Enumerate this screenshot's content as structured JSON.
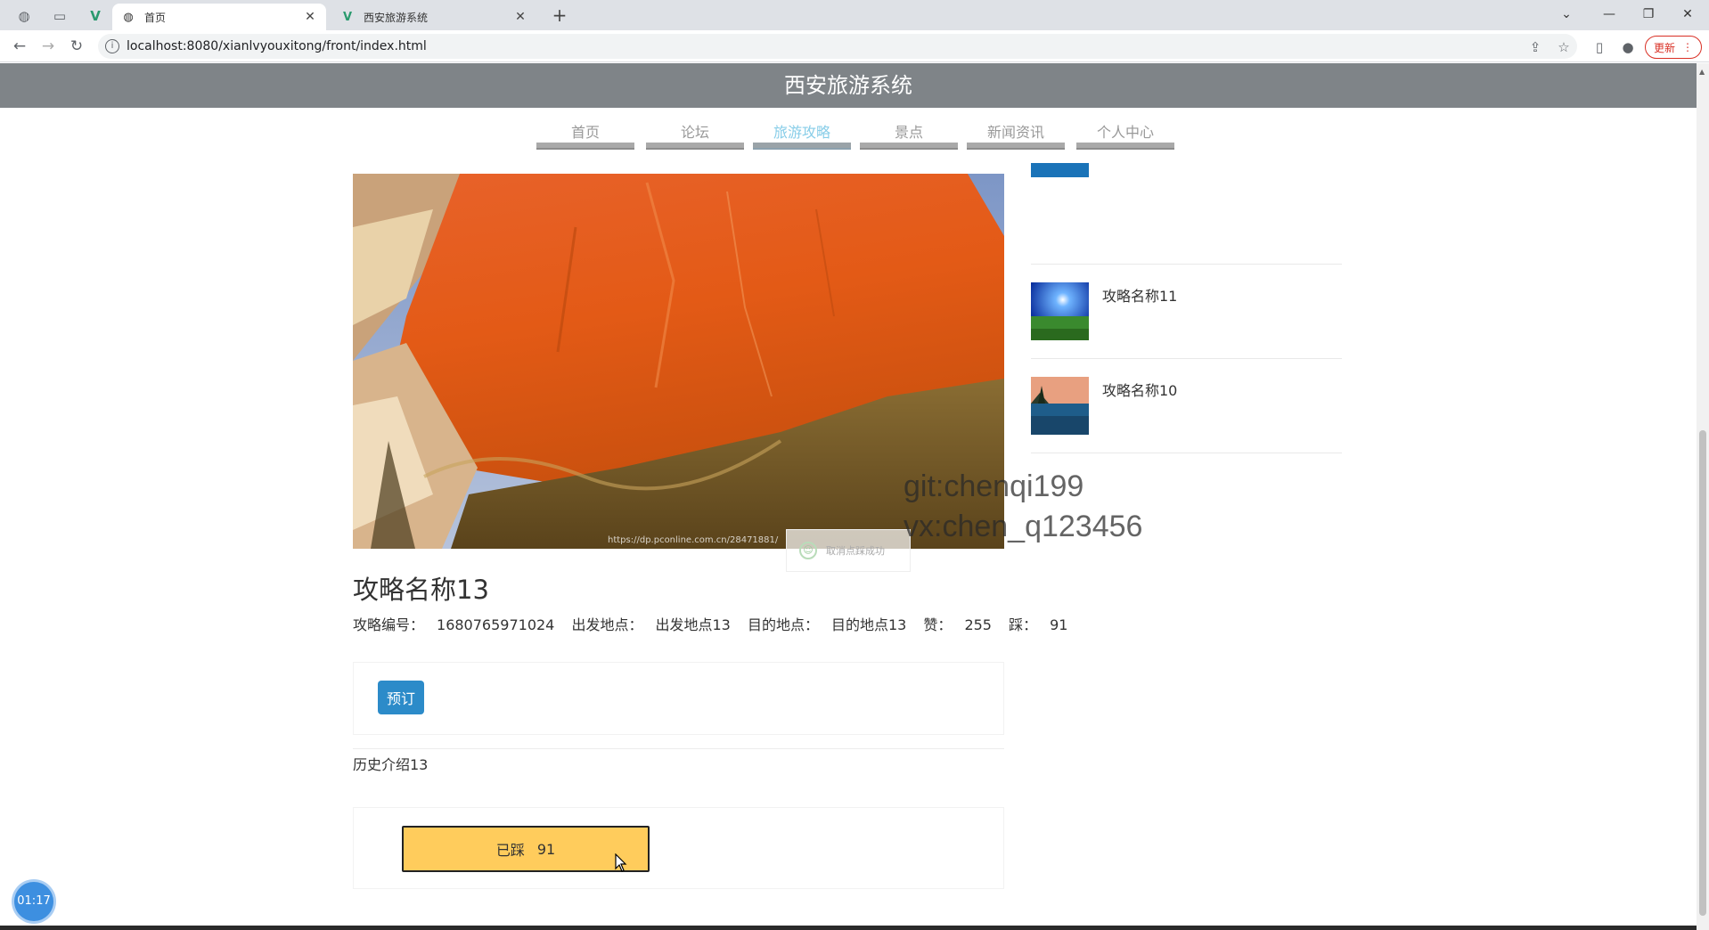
{
  "browser": {
    "tabs": [
      {
        "title": "首页",
        "icon": "globe-icon",
        "active": true
      },
      {
        "title": "西安旅游系统",
        "icon": "vue-logo-icon",
        "active": false
      }
    ],
    "new_tab": "+",
    "address": "localhost:8080/xianlvyouxitong/front/index.html",
    "update_label": "更新",
    "window_controls": {
      "dropdown": "⌄",
      "minimize": "—",
      "restore": "❐",
      "close": "✕"
    }
  },
  "site": {
    "title": "西安旅游系统",
    "nav": [
      {
        "label": "首页",
        "active": false
      },
      {
        "label": "论坛",
        "active": false
      },
      {
        "label": "旅游攻略",
        "active": true
      },
      {
        "label": "景点",
        "active": false
      },
      {
        "label": "新闻资讯",
        "active": false
      },
      {
        "label": "个人中心",
        "active": false
      }
    ],
    "accent_color": "#87cde8"
  },
  "detail": {
    "image_source": "https://dp.pconline.com.cn/28471881/",
    "title": "攻略名称13",
    "meta": {
      "code_label": "攻略编号：",
      "code_value": "1680765971024",
      "from_label": "出发地点：",
      "from_value": "出发地点13",
      "to_label": "目的地点：",
      "to_value": "目的地点13",
      "like_label": "赞：",
      "like_value": "255",
      "tread_label": "踩：",
      "tread_value": "91"
    },
    "book_button": "预订",
    "history": "历史介绍13",
    "tread_button": {
      "label": "已踩",
      "count": "91"
    }
  },
  "sidebar": {
    "items": [
      {
        "name": "攻略名称11"
      },
      {
        "name": "攻略名称10"
      }
    ]
  },
  "toast": {
    "text": "取消点踩成功"
  },
  "watermark": {
    "line1": "git:chenqi199",
    "line2": "vx:chen_q123456"
  },
  "timer": "01:17"
}
